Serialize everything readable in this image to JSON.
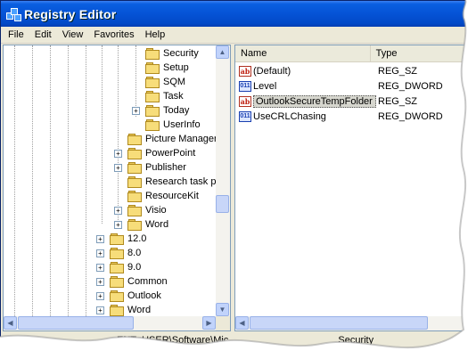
{
  "window": {
    "title": "Registry Editor"
  },
  "menu": [
    "File",
    "Edit",
    "View",
    "Favorites",
    "Help"
  ],
  "tree": {
    "items": [
      {
        "label": "Security",
        "indent": 3,
        "expander": "none"
      },
      {
        "label": "Setup",
        "indent": 3,
        "expander": "none"
      },
      {
        "label": "SQM",
        "indent": 3,
        "expander": "none"
      },
      {
        "label": "Task",
        "indent": 3,
        "expander": "none"
      },
      {
        "label": "Today",
        "indent": 3,
        "expander": "plus"
      },
      {
        "label": "UserInfo",
        "indent": 3,
        "expander": "none"
      },
      {
        "label": "Picture Manager",
        "indent": 2,
        "expander": "none"
      },
      {
        "label": "PowerPoint",
        "indent": 2,
        "expander": "plus"
      },
      {
        "label": "Publisher",
        "indent": 2,
        "expander": "plus"
      },
      {
        "label": "Research task p",
        "indent": 2,
        "expander": "none"
      },
      {
        "label": "ResourceKit",
        "indent": 2,
        "expander": "none"
      },
      {
        "label": "Visio",
        "indent": 2,
        "expander": "plus"
      },
      {
        "label": "Word",
        "indent": 2,
        "expander": "plus"
      },
      {
        "label": "12.0",
        "indent": 1,
        "expander": "plus"
      },
      {
        "label": "8.0",
        "indent": 1,
        "expander": "plus"
      },
      {
        "label": "9.0",
        "indent": 1,
        "expander": "plus"
      },
      {
        "label": "Common",
        "indent": 1,
        "expander": "plus"
      },
      {
        "label": "Outlook",
        "indent": 1,
        "expander": "plus"
      },
      {
        "label": "Word",
        "indent": 1,
        "expander": "plus"
      }
    ]
  },
  "list": {
    "columns": [
      "Name",
      "Type"
    ],
    "rows": [
      {
        "name": "(Default)",
        "type": "REG_SZ",
        "icon": "string-value-icon",
        "selected": false
      },
      {
        "name": "Level",
        "type": "REG_DWORD",
        "icon": "dword-value-icon",
        "selected": false
      },
      {
        "name": "OutlookSecureTempFolder",
        "type": "REG_SZ",
        "icon": "string-value-icon",
        "selected": true
      },
      {
        "name": "UseCRLChasing",
        "type": "REG_DWORD",
        "icon": "dword-value-icon",
        "selected": false
      }
    ]
  },
  "status": {
    "path": "ENT_USER\\Software\\Mic",
    "tail": "Security"
  },
  "colors": {
    "title_bar": "#0553d6",
    "selection": "#d6d6ce",
    "tree_border": "#7f9db9"
  }
}
